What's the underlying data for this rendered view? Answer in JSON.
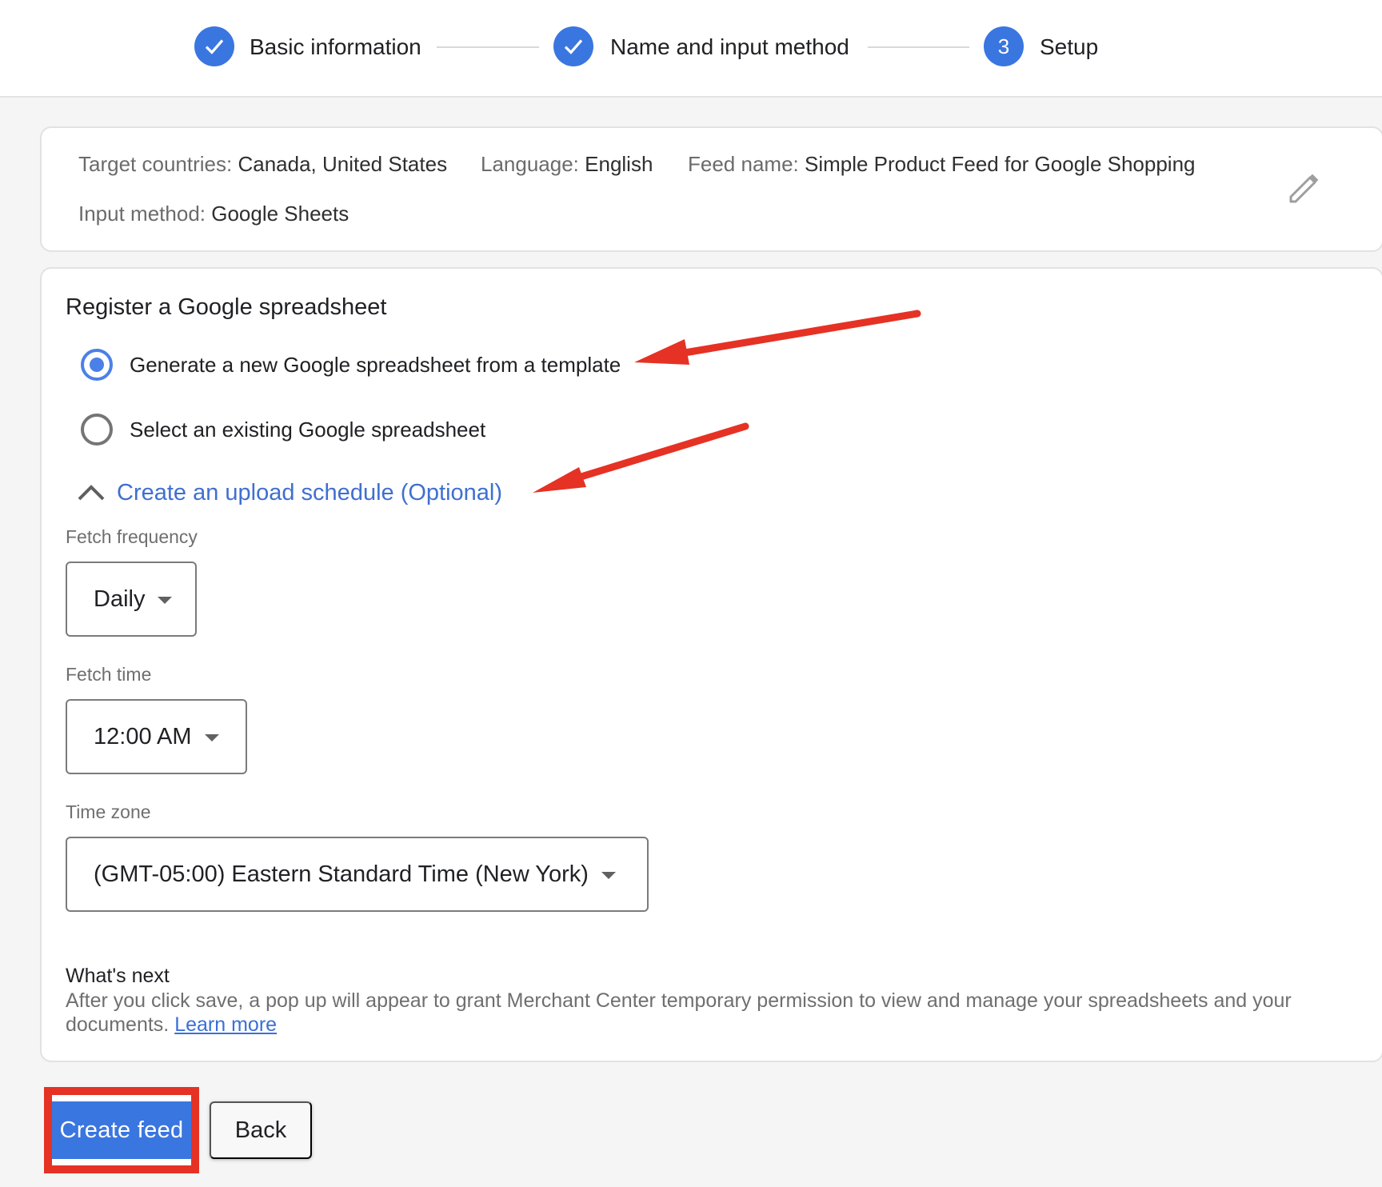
{
  "stepper": {
    "steps": [
      {
        "label": "Basic information",
        "state": "complete",
        "icon": "check-icon"
      },
      {
        "label": "Name and input method",
        "state": "complete",
        "icon": "check-icon"
      },
      {
        "label": "Setup",
        "state": "active",
        "number": "3"
      }
    ],
    "accent_color": "#3a76e0"
  },
  "summary": {
    "target_countries_label": "Target countries:",
    "target_countries_value": "Canada, United States",
    "language_label": "Language:",
    "language_value": "English",
    "feed_name_label": "Feed name:",
    "feed_name_value": "Simple Product Feed for Google Shopping",
    "input_method_label": "Input method:",
    "input_method_value": "Google Sheets",
    "edit_icon": "pencil-icon"
  },
  "register": {
    "title": "Register a Google spreadsheet",
    "options": [
      {
        "label": "Generate a new Google spreadsheet from a template",
        "selected": true
      },
      {
        "label": "Select an existing Google spreadsheet",
        "selected": false
      }
    ],
    "schedule_toggle": {
      "label": "Create an upload schedule (Optional)",
      "expanded": true,
      "icon": "chevron-up-icon"
    },
    "fetch_frequency": {
      "label": "Fetch frequency",
      "value": "Daily"
    },
    "fetch_time": {
      "label": "Fetch time",
      "value": "12:00 AM"
    },
    "time_zone": {
      "label": "Time zone",
      "value": "(GMT-05:00) Eastern Standard Time (New York)"
    },
    "whats_next": {
      "title": "What's next",
      "body": "After you click save, a pop up will appear to grant Merchant Center temporary permission to view and manage your spreadsheets and your documents.",
      "link": "Learn more"
    }
  },
  "actions": {
    "create_label": "Create feed",
    "back_label": "Back"
  },
  "annotation_color": "#e53224"
}
